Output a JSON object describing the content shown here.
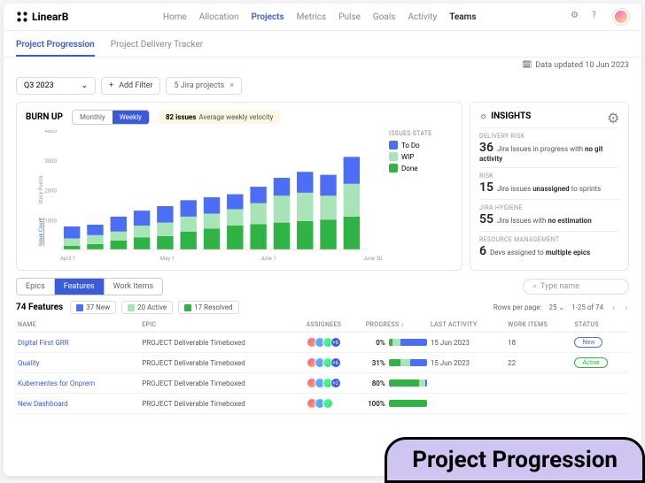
{
  "brand": "LinearB",
  "nav": [
    "Home",
    "Allocation",
    "Projects",
    "Metrics",
    "Pulse",
    "Goals",
    "Activity",
    "Teams"
  ],
  "nav_active": 2,
  "subtabs": [
    "Project Progression",
    "Project Delivery Tracker"
  ],
  "subtab_active": 0,
  "updated": "Data updated 10 Jun 2023",
  "filter_period": "Q3 2023",
  "filter_add": "Add Filter",
  "filter_chip": "5 Jira projects",
  "burnup_label": "BURN UP",
  "toggles": [
    "Monthly",
    "Weekly"
  ],
  "toggle_active": 1,
  "velocity_num": "82 issues",
  "velocity_text": "Average weekly velocity",
  "legend_title": "ISSUES STATE",
  "legend": {
    "todo": "To Do",
    "wip": "WIP",
    "done": "Done"
  },
  "y_label": "Story Points",
  "y_label2": "Issue Count",
  "insights_title": "INSIGHTS",
  "insights": [
    {
      "label": "DELIVERY RISK",
      "num": "36",
      "text": "Jira Issues in progress with <b>no git activity</b>"
    },
    {
      "label": "RISK",
      "num": "15",
      "text": "Jira issues <b>unassigned</b> to sprints"
    },
    {
      "label": "JIRA HYGIENE",
      "num": "55",
      "text": "Jira Issues with <b>no estimation</b>"
    },
    {
      "label": "RESOURCE MANAGEMENT",
      "num": "6",
      "text": "Devs assigned to <b>multiple epics</b>"
    }
  ],
  "type_tabs": [
    "Epics",
    "Features",
    "Work Items"
  ],
  "type_tab_active": 1,
  "search_placeholder": "Type name",
  "features_count": "74 Features",
  "status_filters": [
    {
      "cls": "new",
      "label": "37 New"
    },
    {
      "cls": "act",
      "label": "20 Active"
    },
    {
      "cls": "res",
      "label": "17 Resolved"
    }
  ],
  "pager": {
    "rpp_label": "Rows per page:",
    "rpp": "25",
    "range": "1-25 of 74"
  },
  "columns": [
    "NAME",
    "EPIC",
    "ASSIGNEES",
    "PROGRESS",
    "LAST ACTIVITY",
    "WORK ITEMS",
    "STATUS"
  ],
  "rows": [
    {
      "name": "Digital First GRR",
      "epic": "PROJECT Deliverable Timeboxed",
      "more": "+6",
      "pct": "0%",
      "p": [
        10,
        20,
        70
      ],
      "date": "15 Jun 2023",
      "wi": "18",
      "status": "New",
      "scls": "new"
    },
    {
      "name": "Quality",
      "epic": "PROJECT Deliverable Timeboxed",
      "more": "+6",
      "pct": "31%",
      "p": [
        31,
        25,
        44
      ],
      "date": "15 Jun 2023",
      "wi": "22",
      "status": "Active",
      "scls": "active"
    },
    {
      "name": "Kubernentes for Onprem",
      "epic": "PROJECT Deliverable Timeboxed",
      "more": "+2",
      "pct": "80%",
      "p": [
        80,
        15,
        5
      ],
      "date": "",
      "wi": "",
      "status": "",
      "scls": ""
    },
    {
      "name": "New Dashboard",
      "epic": "PROJECT Deliverable Timeboxed",
      "more": "",
      "pct": "100%",
      "p": [
        100,
        0,
        0
      ],
      "date": "",
      "wi": "",
      "status": "",
      "scls": ""
    }
  ],
  "banner": "Project Progression",
  "chart_data": {
    "type": "bar",
    "stacked": true,
    "x_labels": [
      "April 1",
      "May 1",
      "June 1",
      "June 30"
    ],
    "ylim": [
      0,
      4000
    ],
    "y_ticks": [
      1000,
      2000,
      3000,
      4000
    ],
    "series_keys": [
      "done",
      "wip",
      "todo"
    ],
    "weeks": [
      {
        "done": 120,
        "wip": 250,
        "todo": 400
      },
      {
        "done": 180,
        "wip": 300,
        "todo": 350
      },
      {
        "done": 300,
        "wip": 300,
        "todo": 500
      },
      {
        "done": 400,
        "wip": 400,
        "todo": 500
      },
      {
        "done": 450,
        "wip": 450,
        "todo": 550
      },
      {
        "done": 600,
        "wip": 500,
        "todo": 550
      },
      {
        "done": 700,
        "wip": 500,
        "todo": 550
      },
      {
        "done": 800,
        "wip": 550,
        "todo": 500
      },
      {
        "done": 850,
        "wip": 700,
        "todo": 550
      },
      {
        "done": 900,
        "wip": 900,
        "todo": 600
      },
      {
        "done": 950,
        "wip": 950,
        "todo": 700
      },
      {
        "done": 1000,
        "wip": 800,
        "todo": 700
      },
      {
        "done": 1100,
        "wip": 1100,
        "todo": 900
      }
    ]
  }
}
